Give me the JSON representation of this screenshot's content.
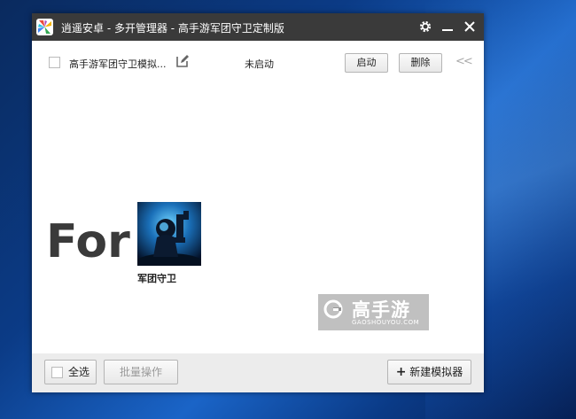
{
  "window": {
    "title": "逍遥安卓 - 多开管理器 - 高手游军团守卫定制版"
  },
  "titlebar_icons": [
    "gear-icon",
    "minimize-icon",
    "close-icon"
  ],
  "instances": [
    {
      "name": "高手游军团守卫模拟...",
      "status": "未启动",
      "start_label": "启动",
      "delete_label": "删除"
    }
  ],
  "collapse_label": "<<",
  "promo": {
    "for_text": "For",
    "game_name": "军团守卫"
  },
  "watermark": {
    "name": "高手游",
    "url": "GAOSHOUYOU.COM"
  },
  "footer": {
    "select_all_label": "全选",
    "batch_label": "批量操作",
    "new_label": "新建模拟器",
    "new_icon": "+"
  }
}
